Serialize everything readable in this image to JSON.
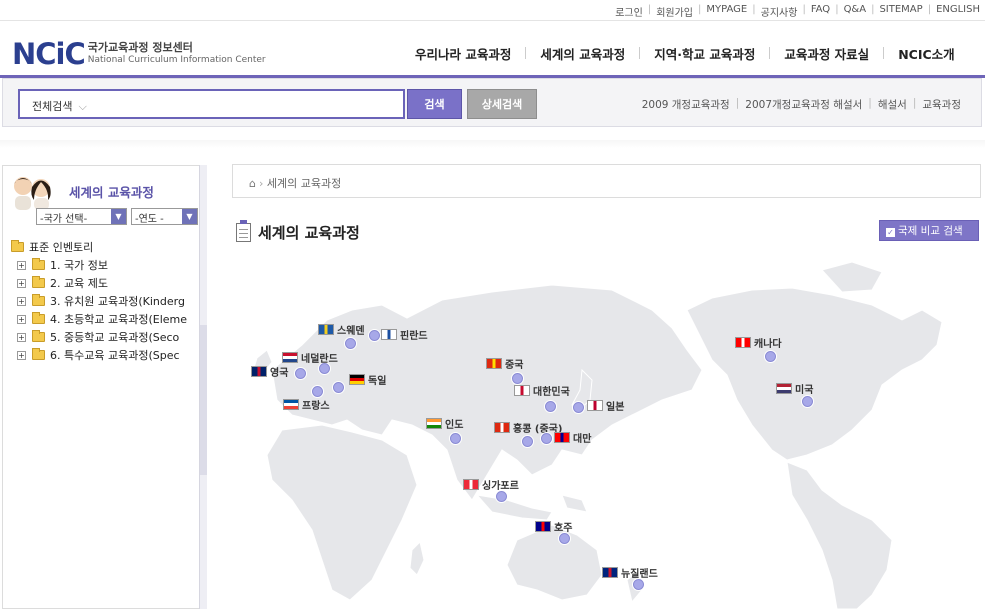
{
  "top_links": [
    "로그인",
    "회원가입",
    "MYPAGE",
    "공지사항",
    "FAQ",
    "Q&A",
    "SITEMAP",
    "ENGLISH"
  ],
  "logo": {
    "mark": "NCiC",
    "kr": "국가교육과정 정보센터",
    "en": "National Curriculum Information Center"
  },
  "gnb": [
    "우리나라 교육과정",
    "세계의 교육과정",
    "지역·학교 교육과정",
    "교육과정 자료실",
    "NCIC소개"
  ],
  "search": {
    "scope": "전체검색",
    "button": "검색",
    "advanced": "상세검색"
  },
  "quick_links": [
    "2009 개정교육과정",
    "2007개정교육과정 해설서",
    "해설서",
    "교육과정"
  ],
  "sidebar": {
    "title": "세계의 교육과정",
    "country_select": "-국가 선택-",
    "year_select": "-연도 -",
    "root": "표준 인벤토리",
    "items": [
      "1. 국가 정보",
      "2. 교육 제도",
      "3. 유치원 교육과정(Kinderg",
      "4. 초등학교 교육과정(Eleme",
      "5. 중등학교 교육과정(Seco",
      "6. 특수교육 교육과정(Spec"
    ]
  },
  "breadcrumb": "세계의 교육과정",
  "page_title": "세계의 교육과정",
  "compare_button": "국제 비교 검색",
  "countries": [
    {
      "name": "스웨덴"
    },
    {
      "name": "핀란드"
    },
    {
      "name": "네덜란드"
    },
    {
      "name": "영국"
    },
    {
      "name": "독일"
    },
    {
      "name": "프랑스"
    },
    {
      "name": "중국"
    },
    {
      "name": "대한민국"
    },
    {
      "name": "일본"
    },
    {
      "name": "인도"
    },
    {
      "name": "홍콩 (중국)"
    },
    {
      "name": "대만"
    },
    {
      "name": "싱가포르"
    },
    {
      "name": "호주"
    },
    {
      "name": "뉴질랜드"
    },
    {
      "name": "캐나다"
    },
    {
      "name": "미국"
    }
  ],
  "colors": {
    "accent": "#6e64b8",
    "button": "#7a71c8",
    "map_land": "#e6e7ea",
    "pin": "#a7a8e8"
  }
}
